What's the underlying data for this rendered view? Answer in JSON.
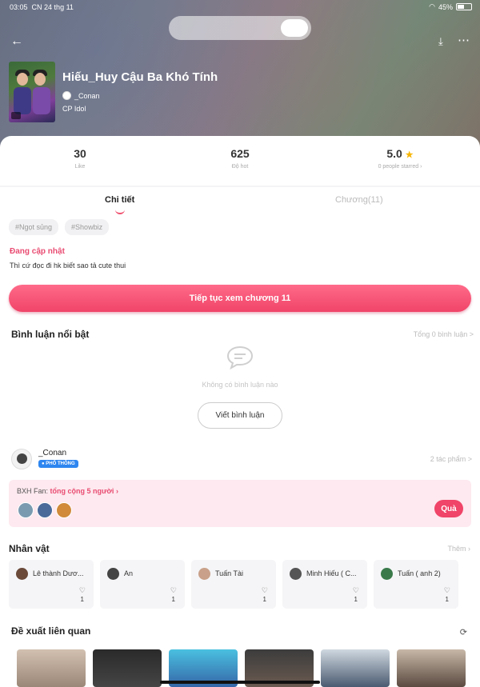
{
  "status_bar": {
    "time": "03:05",
    "date": "CN 24 thg 11",
    "battery": "45%"
  },
  "header": {
    "title": "Hiếu_Huy Cậu Ba Khó Tính",
    "author": "_Conan",
    "category": "CP Idol"
  },
  "stats": [
    {
      "value": "30",
      "label": "Like"
    },
    {
      "value": "625",
      "label": "Độ hot"
    },
    {
      "value": "5.0",
      "label": "0 people starred"
    }
  ],
  "tabs": {
    "details": "Chi tiết",
    "chapters": "Chương(11)"
  },
  "tags": [
    "#Ngọt sủng",
    "#Showbiz"
  ],
  "story": {
    "status": "Đang cập nhật",
    "description": "Thì cứ đọc đi hk biết sao tả cute thui",
    "continue_label": "Tiếp tục xem chương 11"
  },
  "comments": {
    "title": "Bình luận nổi bật",
    "total": "Tổng 0 bình luận >",
    "empty": "Không có bình luận nào",
    "write": "Viết bình luận"
  },
  "author_section": {
    "name": "_Conan",
    "badge": "PHỔ THÔNG",
    "works": "2 tác phẩm >"
  },
  "fan": {
    "prefix": "BXH Fan: ",
    "highlight": "tổng cộng 5 người",
    "gift": "Quà"
  },
  "characters": {
    "title": "Nhân vật",
    "more": "Thêm",
    "items": [
      {
        "name": "Lê thành Dươ...",
        "count": "1",
        "color": "#6b4a3a"
      },
      {
        "name": "An",
        "count": "1",
        "color": "#444"
      },
      {
        "name": "Tuấn Tài",
        "count": "1",
        "color": "#c9a089"
      },
      {
        "name": "Minh Hiếu ( C...",
        "count": "1",
        "color": "#555"
      },
      {
        "name": "Tuấn ( anh 2)",
        "count": "1",
        "color": "#3a7a4a"
      }
    ]
  },
  "related": {
    "title": "Đề xuất liên quan"
  },
  "colors": {
    "accent": "#f04468",
    "accent_light": "#fde9ef",
    "badge": "#2e86f0"
  }
}
